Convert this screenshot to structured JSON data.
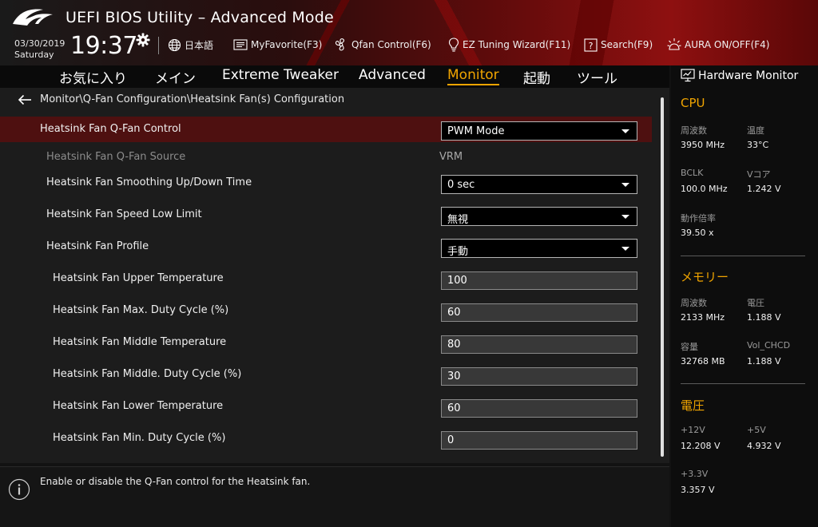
{
  "header": {
    "title": "UEFI BIOS Utility – Advanced Mode",
    "date": "03/30/2019",
    "day": "Saturday",
    "time": "19:37",
    "tools": [
      {
        "label": "日本語",
        "icon": "globe-icon"
      },
      {
        "label": "MyFavorite(F3)",
        "icon": "favorite-icon"
      },
      {
        "label": "Qfan Control(F6)",
        "icon": "fan-icon"
      },
      {
        "label": "EZ Tuning Wizard(F11)",
        "icon": "lightbulb-icon"
      },
      {
        "label": "Search(F9)",
        "icon": "help-box-icon"
      },
      {
        "label": "AURA ON/OFF(F4)",
        "icon": "aura-icon"
      }
    ]
  },
  "nav": {
    "tabs": [
      {
        "label": "お気に入り"
      },
      {
        "label": "メイン"
      },
      {
        "label": "Extreme Tweaker"
      },
      {
        "label": "Advanced"
      },
      {
        "label": "Monitor"
      },
      {
        "label": "起動"
      },
      {
        "label": "ツール"
      }
    ],
    "active": "Monitor"
  },
  "breadcrumb": "Monitor\\Q-Fan Configuration\\Heatsink Fan(s) Configuration",
  "settings": [
    {
      "label": "Heatsink Fan Q-Fan Control",
      "type": "select",
      "value": "PWM Mode"
    },
    {
      "label": "Heatsink Fan Q-Fan Source",
      "type": "static",
      "value": "VRM"
    },
    {
      "label": "Heatsink Fan Smoothing Up/Down Time",
      "type": "select",
      "value": "0 sec"
    },
    {
      "label": "Heatsink Fan Speed Low Limit",
      "type": "select",
      "value": "無視"
    },
    {
      "label": "Heatsink Fan Profile",
      "type": "select",
      "value": "手動"
    },
    {
      "label": "Heatsink Fan Upper Temperature",
      "type": "number",
      "value": "100"
    },
    {
      "label": "Heatsink Fan Max. Duty Cycle (%)",
      "type": "number",
      "value": "60"
    },
    {
      "label": "Heatsink Fan Middle Temperature",
      "type": "number",
      "value": "80"
    },
    {
      "label": "Heatsink Fan Middle. Duty Cycle (%)",
      "type": "number",
      "value": "30"
    },
    {
      "label": "Heatsink Fan Lower Temperature",
      "type": "number",
      "value": "60"
    },
    {
      "label": "Heatsink Fan Min. Duty Cycle (%)",
      "type": "number",
      "value": "0"
    }
  ],
  "help": {
    "text": "Enable or disable the Q-Fan control for the Heatsink fan."
  },
  "hw_monitor": {
    "title": "Hardware Monitor",
    "cpu": {
      "title": "CPU",
      "freq_label": "周波数",
      "freq": "3950 MHz",
      "temp_label": "温度",
      "temp": "33°C",
      "bclk_label": "BCLK",
      "bclk": "100.0 MHz",
      "vcore_label": "Vコア",
      "vcore": "1.242 V",
      "ratio_label": "動作倍率",
      "ratio": "39.50 x"
    },
    "memory": {
      "title": "メモリー",
      "freq_label": "周波数",
      "freq": "2133 MHz",
      "volt_label": "電圧",
      "volt": "1.188 V",
      "cap_label": "容量",
      "cap": "32768 MB",
      "chcd_label": "Vol_CHCD",
      "chcd": "1.188 V"
    },
    "voltage": {
      "title": "電圧",
      "v12_label": "+12V",
      "v12": "12.208 V",
      "v5_label": "+5V",
      "v5": "4.932 V",
      "v33_label": "+3.3V",
      "v33": "3.357 V"
    }
  },
  "colors": {
    "accent": "#f0a400",
    "selected_row": "#4e1010"
  }
}
